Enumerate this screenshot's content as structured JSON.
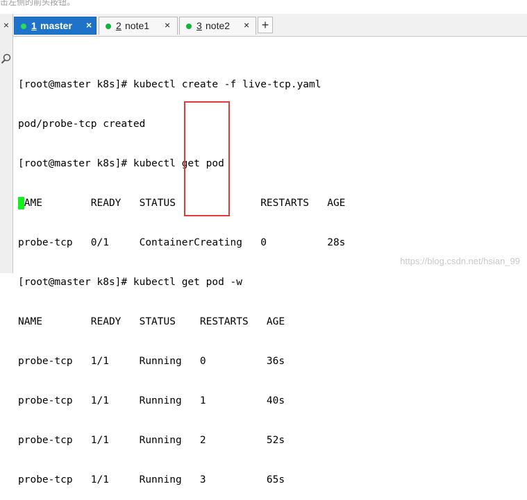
{
  "top_hint": "击左侧的前头按钮。",
  "tabs": [
    {
      "num": "1",
      "name": "master",
      "active": true
    },
    {
      "num": "2",
      "name": "note1",
      "active": false
    },
    {
      "num": "3",
      "name": "note2",
      "active": false
    }
  ],
  "icons": {
    "close": "×",
    "add": "+",
    "search": "search-icon"
  },
  "colors": {
    "active_tab": "#1e73c9",
    "status_dot": "#11b53b",
    "cursor": "#13f020",
    "highlight": "#e23b3b"
  },
  "terminal": {
    "lines": [
      "[root@master k8s]# kubectl create -f live-tcp.yaml",
      "pod/probe-tcp created",
      "[root@master k8s]# kubectl get pod",
      "NAME        READY   STATUS              RESTARTS   AGE",
      "probe-tcp   0/1     ContainerCreating   0          28s",
      "[root@master k8s]# kubectl get pod -w",
      "NAME        READY   STATUS    RESTARTS   AGE",
      "probe-tcp   1/1     Running   0          36s",
      "probe-tcp   1/1     Running   1          40s",
      "probe-tcp   1/1     Running   2          52s",
      "probe-tcp   1/1     Running   3          65s"
    ]
  },
  "watermark": "https://blog.csdn.net/hsian_99"
}
